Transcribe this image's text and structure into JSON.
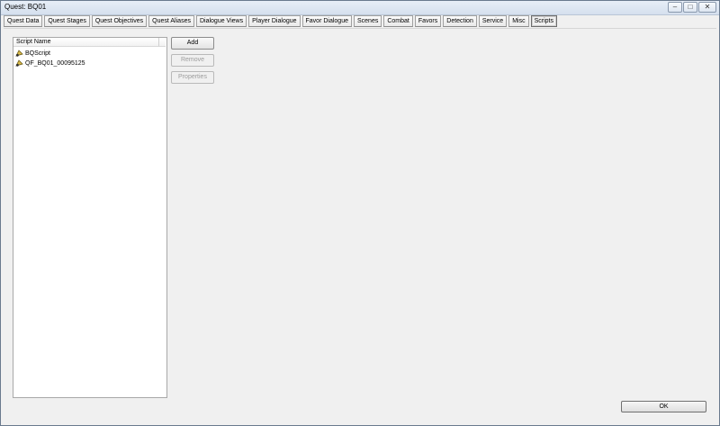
{
  "window": {
    "title": "Quest: BQ01",
    "minimize_label": "–",
    "maximize_label": "□",
    "close_label": "✕"
  },
  "tabs": [
    {
      "label": "Quest Data"
    },
    {
      "label": "Quest Stages"
    },
    {
      "label": "Quest Objectives"
    },
    {
      "label": "Quest Aliases"
    },
    {
      "label": "Dialogue Views"
    },
    {
      "label": "Player Dialogue"
    },
    {
      "label": "Favor Dialogue"
    },
    {
      "label": "Scenes"
    },
    {
      "label": "Combat"
    },
    {
      "label": "Favors"
    },
    {
      "label": "Detection"
    },
    {
      "label": "Service"
    },
    {
      "label": "Misc"
    },
    {
      "label": "Scripts",
      "active": true
    }
  ],
  "scripts_list": {
    "column_header": "Script Name",
    "items": [
      {
        "name": "BQScript",
        "icon": "script-icon"
      },
      {
        "name": "QF_BQ01_00095125",
        "icon": "script-icon"
      }
    ]
  },
  "buttons": {
    "add": "Add",
    "remove": "Remove",
    "properties": "Properties",
    "ok": "OK"
  }
}
